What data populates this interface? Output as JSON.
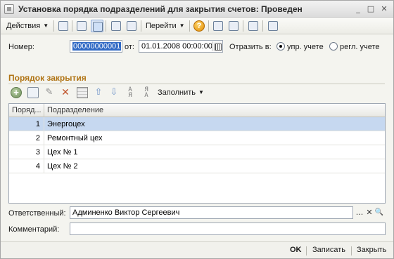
{
  "window": {
    "title": "Установка порядка подразделений для закрытия счетов: Проведен",
    "controls": [
      "_",
      "□",
      "✕"
    ]
  },
  "toolbar": {
    "actions_label": "Действия",
    "goto_label": "Перейти",
    "help_glyph": "?",
    "icons": [
      "post-and-close-icon",
      "refresh-icon",
      "post-document-icon",
      "copy-icon",
      "structure-icon",
      "list-icon",
      "tree-list-icon",
      "preview-icon",
      "report-icon"
    ]
  },
  "form": {
    "number_label": "Номер:",
    "number_value": "00000000001",
    "date_label": "от:",
    "date_value": "01.01.2008 00:00:00",
    "reflect_label": "Отразить в:",
    "radio_mgmt_label": "упр. учете",
    "radio_reg_label": "регл. учете",
    "radio_selected": "упр. учете"
  },
  "section": {
    "title": "Порядок закрытия"
  },
  "table_toolbar": {
    "fill_label": "Заполнить",
    "icons": [
      "add-icon",
      "add-copy-icon",
      "edit-icon",
      "delete-icon",
      "table-icon",
      "move-up-icon",
      "move-down-icon",
      "sort-asc-icon",
      "sort-desc-icon"
    ]
  },
  "table": {
    "columns": [
      "Поряд...",
      "Подразделение"
    ],
    "rows": [
      {
        "order": "1",
        "department": "Энергоцех"
      },
      {
        "order": "2",
        "department": "Ремонтный цех"
      },
      {
        "order": "3",
        "department": "Цех № 1"
      },
      {
        "order": "4",
        "department": "Цех № 2"
      }
    ],
    "selected_row": 1
  },
  "responsible": {
    "label": "Ответственный:",
    "value": "Админенко Виктор Сергеевич",
    "select_glyph": "...",
    "clear_glyph": "✕",
    "open_glyph": "🔍"
  },
  "comment": {
    "label": "Комментарий:",
    "value": ""
  },
  "bottom": {
    "ok_label": "OK",
    "save_label": "Записать",
    "close_label": "Закрыть"
  }
}
